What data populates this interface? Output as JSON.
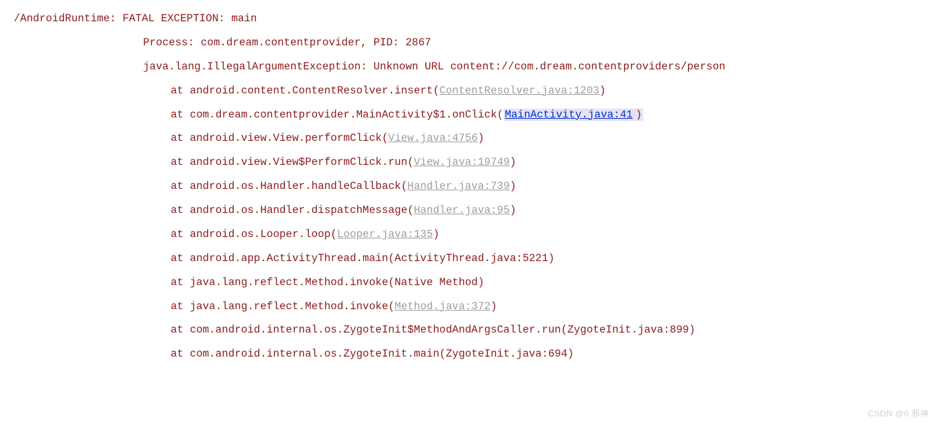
{
  "log": {
    "tag": "/AndroidRuntime:",
    "header": "FATAL EXCEPTION: main",
    "process": "Process: com.dream.contentprovider, PID: 2867",
    "exception": "java.lang.IllegalArgumentException: Unknown URL content://com.dream.contentproviders/person",
    "stack": [
      {
        "prefix": "at android.content.ContentResolver.insert(",
        "link": "ContentResolver.java:1203",
        "suffix": ")",
        "style": "gray"
      },
      {
        "prefix": "at com.dream.contentprovider.MainActivity$1.onClick(",
        "link": "MainActivity.java:41",
        "suffix": ")",
        "style": "blue-highlight"
      },
      {
        "prefix": "at android.view.View.performClick(",
        "link": "View.java:4756",
        "suffix": ")",
        "style": "gray"
      },
      {
        "prefix": "at android.view.View$PerformClick.run(",
        "link": "View.java:19749",
        "suffix": ")",
        "style": "gray"
      },
      {
        "prefix": "at android.os.Handler.handleCallback(",
        "link": "Handler.java:739",
        "suffix": ")",
        "style": "gray"
      },
      {
        "prefix": "at android.os.Handler.dispatchMessage(",
        "link": "Handler.java:95",
        "suffix": ")",
        "style": "gray"
      },
      {
        "prefix": "at android.os.Looper.loop(",
        "link": "Looper.java:135",
        "suffix": ")",
        "style": "gray"
      },
      {
        "prefix": "at android.app.ActivityThread.main(ActivityThread.java:5221)",
        "link": "",
        "suffix": "",
        "style": "plain"
      },
      {
        "prefix": "at java.lang.reflect.Method.invoke(Native Method)",
        "link": "",
        "suffix": "",
        "style": "plain"
      },
      {
        "prefix": "at java.lang.reflect.Method.invoke(",
        "link": "Method.java:372",
        "suffix": ")",
        "style": "gray"
      },
      {
        "prefix": "at com.android.internal.os.ZygoteInit$MethodAndArgsCaller.run(ZygoteInit.java:899)",
        "link": "",
        "suffix": "",
        "style": "plain"
      },
      {
        "prefix": "at com.android.internal.os.ZygoteInit.main(ZygoteInit.java:694)",
        "link": "",
        "suffix": "",
        "style": "plain"
      }
    ]
  },
  "watermark": "CSDN @0 邪神"
}
